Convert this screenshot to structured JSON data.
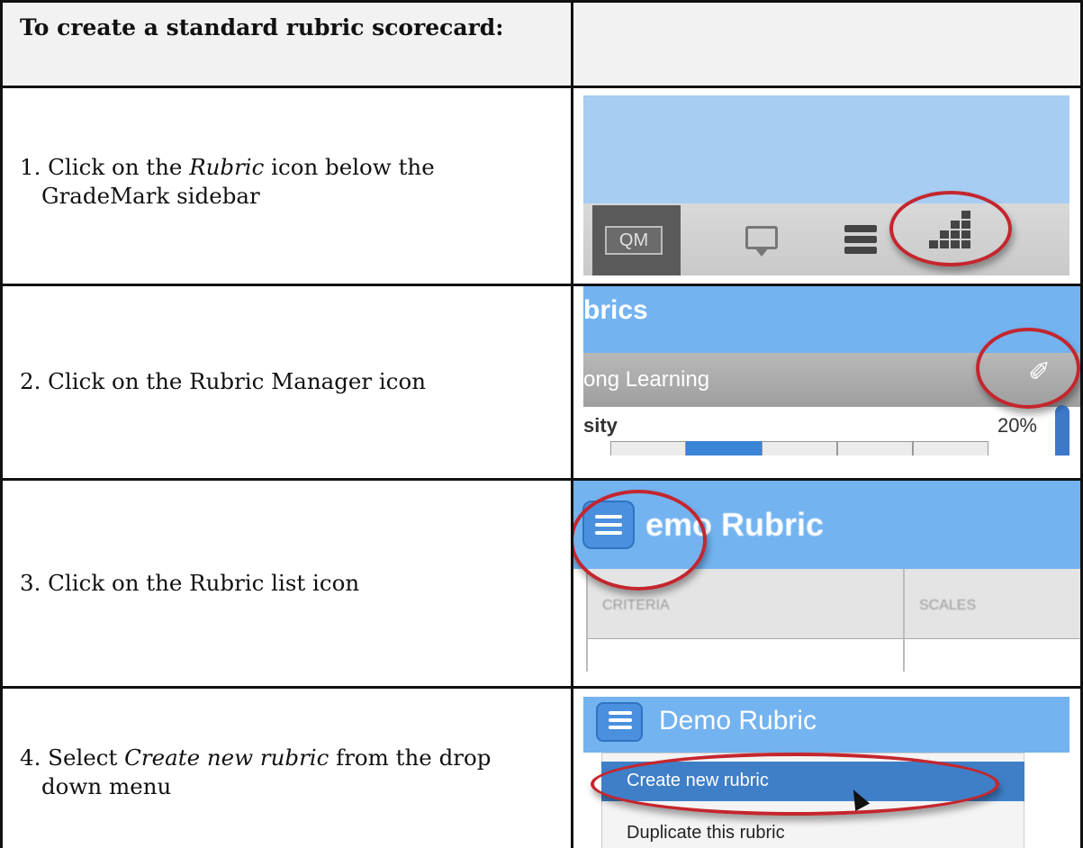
{
  "header": {
    "title": "To create a standard rubric scorecard:"
  },
  "steps": [
    {
      "number": "1.",
      "text_before": " Click on the ",
      "text_em": "Rubric",
      "text_after": " icon below the",
      "text_line2": "GradeMark sidebar"
    },
    {
      "number": "2.",
      "text": " Click on the Rubric Manager icon"
    },
    {
      "number": "3.",
      "text": " Click on the Rubric list icon"
    },
    {
      "number": "4.",
      "text_before": " Select ",
      "text_em": "Create new rubric",
      "text_after": " from the drop",
      "text_line2": "down menu"
    }
  ],
  "screenshots": {
    "step1": {
      "qm_label": "QM"
    },
    "step2": {
      "title_fragment": "brics",
      "bar_fragment": "ong Learning",
      "row_fragment": "sity",
      "percent": "20%"
    },
    "step3": {
      "title_fragment": "emo Rubric",
      "col_criteria": "CRITERIA",
      "col_scales": "SCALES"
    },
    "step4": {
      "title": "Demo Rubric",
      "menu_item_1": "Create new rubric",
      "menu_item_2": "Duplicate this rubric"
    }
  },
  "colors": {
    "highlight_ring": "#c4262e",
    "header_bg": "#f2f2f2",
    "app_blue": "#73b3f0"
  }
}
